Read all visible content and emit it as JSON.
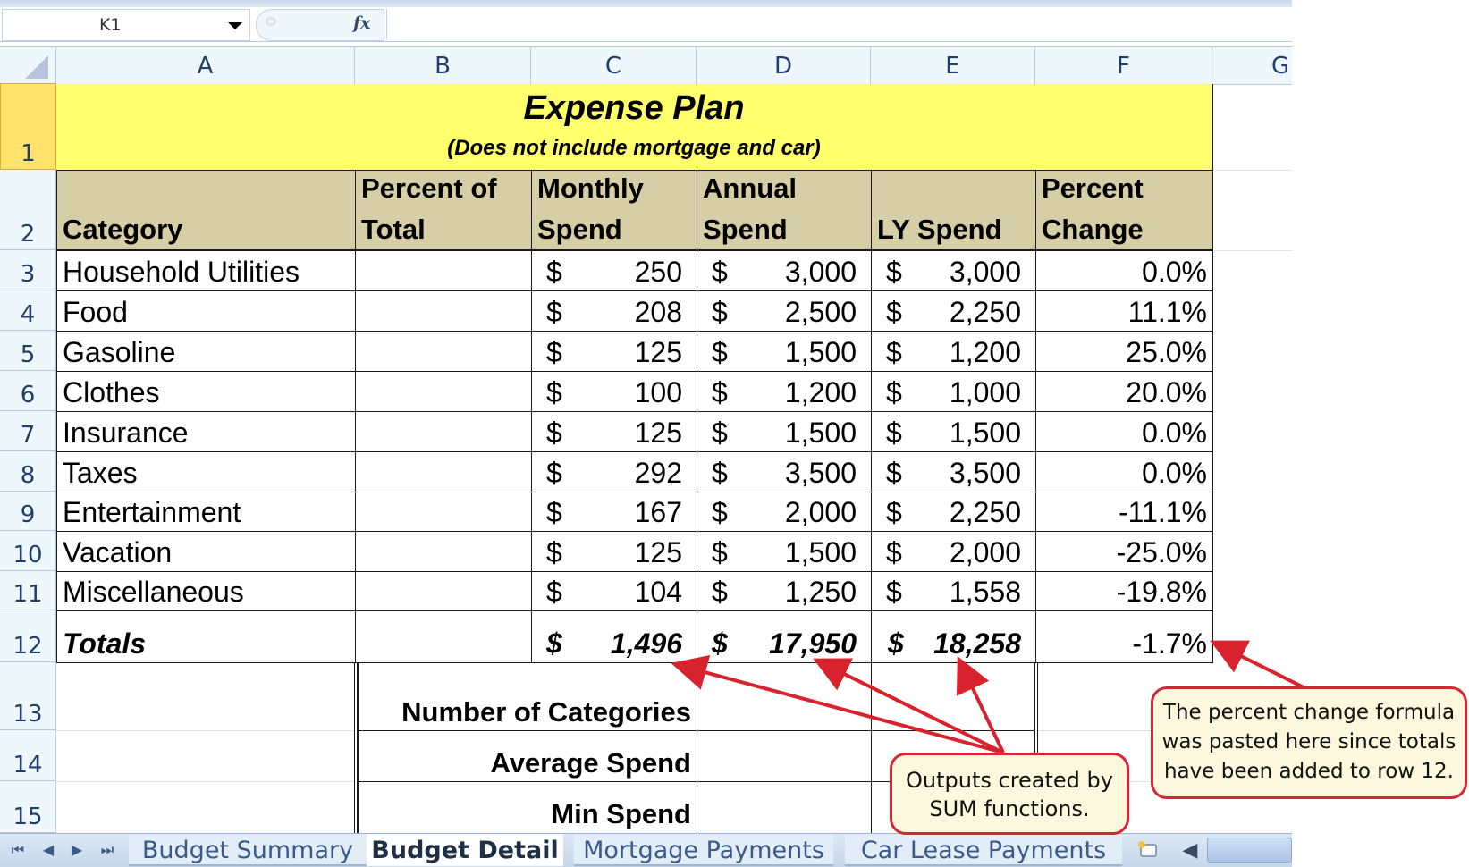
{
  "formula_bar": {
    "name_box": "K1",
    "fx_label": "fx",
    "formula": ""
  },
  "columns": [
    "A",
    "B",
    "C",
    "D",
    "E",
    "F",
    "G"
  ],
  "rows": [
    "1",
    "2",
    "3",
    "4",
    "5",
    "6",
    "7",
    "8",
    "9",
    "10",
    "11",
    "12",
    "13",
    "14",
    "15"
  ],
  "sheet": {
    "title": "Expense Plan",
    "subtitle": "(Does not include mortgage and car)",
    "headers": [
      {
        "l1": "",
        "l2": "Category"
      },
      {
        "l1": "Percent of",
        "l2": "Total"
      },
      {
        "l1": "Monthly",
        "l2": "Spend"
      },
      {
        "l1": "Annual",
        "l2": "Spend"
      },
      {
        "l1": "",
        "l2": "LY Spend"
      },
      {
        "l1": "Percent",
        "l2": "Change"
      }
    ],
    "data": [
      {
        "category": "Household Utilities",
        "pct_total": "",
        "monthly": "250",
        "annual": "3,000",
        "ly": "3,000",
        "change": "0.0%"
      },
      {
        "category": "Food",
        "pct_total": "",
        "monthly": "208",
        "annual": "2,500",
        "ly": "2,250",
        "change": "11.1%"
      },
      {
        "category": "Gasoline",
        "pct_total": "",
        "monthly": "125",
        "annual": "1,500",
        "ly": "1,200",
        "change": "25.0%"
      },
      {
        "category": "Clothes",
        "pct_total": "",
        "monthly": "100",
        "annual": "1,200",
        "ly": "1,000",
        "change": "20.0%"
      },
      {
        "category": "Insurance",
        "pct_total": "",
        "monthly": "125",
        "annual": "1,500",
        "ly": "1,500",
        "change": "0.0%"
      },
      {
        "category": "Taxes",
        "pct_total": "",
        "monthly": "292",
        "annual": "3,500",
        "ly": "3,500",
        "change": "0.0%"
      },
      {
        "category": "Entertainment",
        "pct_total": "",
        "monthly": "167",
        "annual": "2,000",
        "ly": "2,250",
        "change": "-11.1%"
      },
      {
        "category": "Vacation",
        "pct_total": "",
        "monthly": "125",
        "annual": "1,500",
        "ly": "2,000",
        "change": "-25.0%"
      },
      {
        "category": "Miscellaneous",
        "pct_total": "",
        "monthly": "104",
        "annual": "1,250",
        "ly": "1,558",
        "change": "-19.8%"
      }
    ],
    "currency_symbol": "$",
    "totals": {
      "label": "Totals",
      "monthly": "1,496",
      "annual": "17,950",
      "ly": "18,258",
      "change": "-1.7%"
    },
    "summary_labels": [
      "Number of Categories",
      "Average Spend",
      "Min Spend"
    ]
  },
  "tabs": {
    "nav": [
      "first-sheet",
      "prev-sheet",
      "next-sheet",
      "last-sheet"
    ],
    "sheets": [
      "Budget Summary",
      "Budget Detail",
      "Mortgage Payments",
      "Car Lease Payments"
    ],
    "active": "Budget Detail"
  },
  "callouts": {
    "sum": "Outputs created by SUM functions.",
    "sum_lines": [
      "Outputs created by",
      "SUM functions."
    ],
    "pct_lines": [
      "The percent change formula",
      "was pasted here since totals",
      "have been added to row 12."
    ]
  },
  "colors": {
    "title_fill": "#ffff6e",
    "header_fill": "#d5cea7",
    "callout_border": "#d32833",
    "callout_fill": "#fcf8dd",
    "arrow": "#d8232e"
  }
}
